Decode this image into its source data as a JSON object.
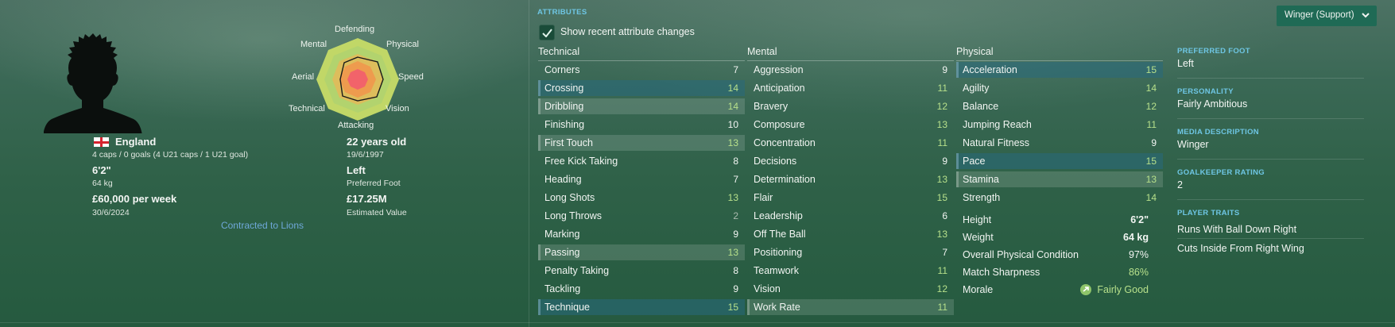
{
  "profile": {
    "nationality": "England",
    "caps": "4 caps / 0 goals (4 U21 caps / 1 U21 goal)",
    "height": "6'2\"",
    "weight": "64 kg",
    "wage": "£60,000 per week",
    "contract_end": "30/6/2024",
    "age": "22 years old",
    "dob": "19/6/1997",
    "preferred_foot": "Left",
    "preferred_foot_label": "Preferred Foot",
    "value": "£17.25M",
    "value_label": "Estimated Value",
    "contract_link": "Contracted to Lions"
  },
  "radar": {
    "labels": {
      "defending": "Defending",
      "physical": "Physical",
      "speed": "Speed",
      "vision": "Vision",
      "attacking": "Attacking",
      "technical": "Technical",
      "aerial": "Aerial",
      "mental": "Mental"
    }
  },
  "attributes": {
    "section_title": "ATTRIBUTES",
    "show_changes_label": "Show recent attribute changes",
    "show_changes_checked": true,
    "role_selector": "Winger (Support)",
    "technical_title": "Technical",
    "mental_title": "Mental",
    "physical_title": "Physical",
    "technical": [
      {
        "name": "Corners",
        "value": "7"
      },
      {
        "name": "Crossing",
        "value": "14"
      },
      {
        "name": "Dribbling",
        "value": "14"
      },
      {
        "name": "Finishing",
        "value": "10"
      },
      {
        "name": "First Touch",
        "value": "13"
      },
      {
        "name": "Free Kick Taking",
        "value": "8"
      },
      {
        "name": "Heading",
        "value": "7"
      },
      {
        "name": "Long Shots",
        "value": "13"
      },
      {
        "name": "Long Throws",
        "value": "2"
      },
      {
        "name": "Marking",
        "value": "9"
      },
      {
        "name": "Passing",
        "value": "13"
      },
      {
        "name": "Penalty Taking",
        "value": "8"
      },
      {
        "name": "Tackling",
        "value": "9"
      },
      {
        "name": "Technique",
        "value": "15"
      }
    ],
    "mental": [
      {
        "name": "Aggression",
        "value": "9"
      },
      {
        "name": "Anticipation",
        "value": "11"
      },
      {
        "name": "Bravery",
        "value": "12"
      },
      {
        "name": "Composure",
        "value": "13"
      },
      {
        "name": "Concentration",
        "value": "11"
      },
      {
        "name": "Decisions",
        "value": "9"
      },
      {
        "name": "Determination",
        "value": "13"
      },
      {
        "name": "Flair",
        "value": "15"
      },
      {
        "name": "Leadership",
        "value": "6"
      },
      {
        "name": "Off The Ball",
        "value": "13"
      },
      {
        "name": "Positioning",
        "value": "7"
      },
      {
        "name": "Teamwork",
        "value": "11"
      },
      {
        "name": "Vision",
        "value": "12"
      },
      {
        "name": "Work Rate",
        "value": "11"
      }
    ],
    "physical": [
      {
        "name": "Acceleration",
        "value": "15"
      },
      {
        "name": "Agility",
        "value": "14"
      },
      {
        "name": "Balance",
        "value": "12"
      },
      {
        "name": "Jumping Reach",
        "value": "11"
      },
      {
        "name": "Natural Fitness",
        "value": "9"
      },
      {
        "name": "Pace",
        "value": "15"
      },
      {
        "name": "Stamina",
        "value": "13"
      },
      {
        "name": "Strength",
        "value": "14"
      }
    ],
    "physical_stats": [
      {
        "name": "Height",
        "value": "6'2\""
      },
      {
        "name": "Weight",
        "value": "64 kg"
      },
      {
        "name": "Overall Physical Condition",
        "value": "97%"
      },
      {
        "name": "Match Sharpness",
        "value": "86%"
      },
      {
        "name": "Morale",
        "value": "Fairly Good"
      }
    ]
  },
  "sidebar": {
    "preferred_foot_label": "PREFERRED FOOT",
    "preferred_foot": "Left",
    "personality_label": "PERSONALITY",
    "personality": "Fairly Ambitious",
    "media_label": "MEDIA DESCRIPTION",
    "media": "Winger",
    "gk_label": "GOALKEEPER RATING",
    "gk_rating": "2",
    "traits_label": "PLAYER TRAITS",
    "traits": [
      "Runs With Ball Down Right",
      "Cuts Inside From Right Wing"
    ]
  },
  "colors": {
    "accent_blue": "#6ec6e4",
    "value_green": "#b7e08b",
    "link_blue": "#6fa8d9"
  }
}
